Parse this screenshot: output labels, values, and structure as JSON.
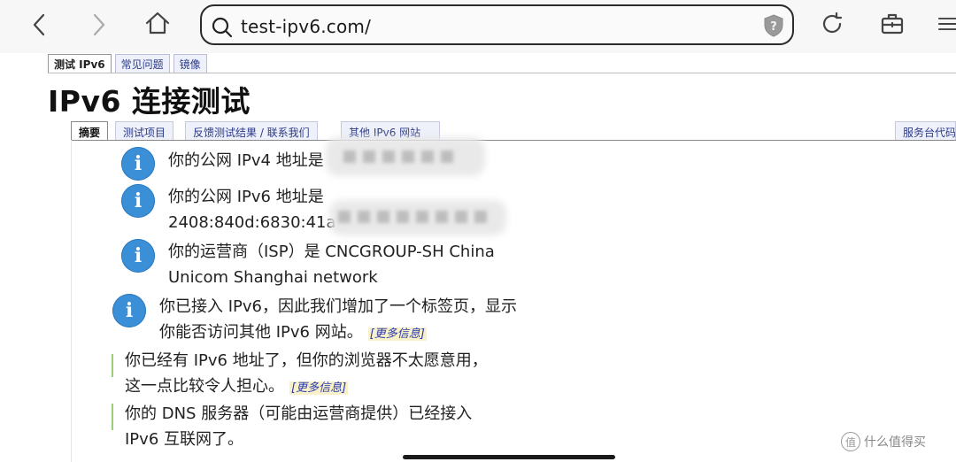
{
  "browser": {
    "url": "test-ipv6.com/"
  },
  "site_tabs": [
    "测试 IPv6",
    "常见问题",
    "镜像"
  ],
  "page_title": "IPv6 连接测试",
  "content_tabs": [
    "摘要",
    "测试项目",
    "反馈测试结果 / 联系我们",
    "其他 IPv6 网站",
    "服务台代码"
  ],
  "messages": {
    "ipv4_line": "你的公网 IPv4 地址是",
    "ipv6_line1": "你的公网 IPv6 地址是",
    "ipv6_line2": "2408:840d:6830:41a",
    "isp_line1": "你的运营商（ISP）是 CNCGROUP-SH China",
    "isp_line2": "Unicom Shanghai network",
    "tab_line1": "你已接入 IPv6，因此我们增加了一个标签页，显示",
    "tab_line2": "你能否访问其他 IPv6 网站。",
    "browser_line1": "你已经有 IPv6 地址了，但你的浏览器不太愿意用，",
    "browser_line2": "这一点比较令人担心。",
    "dns_line1": "你的 DNS 服务器（可能由运营商提供）已经接入",
    "dns_line2": "IPv6 互联网了。",
    "more_info": "[更多信息]"
  },
  "watermark": "什么值得买",
  "icons": {
    "back": "chevron-left-icon",
    "forward": "chevron-right-icon",
    "home": "home-icon",
    "search": "search-icon",
    "shield": "shield-icon",
    "reload": "reload-icon",
    "tools": "toolbox-icon",
    "menu": "menu-icon",
    "info": "info-icon"
  },
  "colors": {
    "info_blue": "#3b8fd6",
    "link_blue": "#2a3ab0",
    "tab_bg": "#eef0fa"
  }
}
